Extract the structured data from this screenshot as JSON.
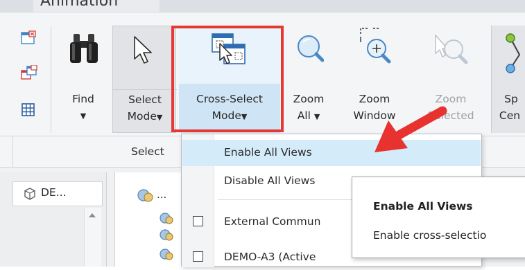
{
  "tab": {
    "label": "Animation"
  },
  "ribbon": {
    "find_label": "Find",
    "select_mode": {
      "line1": "Select",
      "line2": "Mode"
    },
    "cross_select_mode": {
      "line1": "Cross-Select",
      "line2": "Mode"
    },
    "zoom_all": {
      "line1": "Zoom",
      "line2": "All"
    },
    "zoom_window": {
      "line1": "Zoom",
      "line2": "Window"
    },
    "zoom_selected": {
      "line1": "Zoom",
      "line2": "Selected"
    },
    "spin_center": {
      "line1": "Sp",
      "line2": "Cen"
    },
    "group_label": "Select",
    "caret": "▼"
  },
  "panel": {
    "tab_label": "DE..."
  },
  "dropdown": {
    "items": [
      {
        "label": "Enable All Views"
      },
      {
        "label": "Disable All Views"
      },
      {
        "label": "External Commun"
      },
      {
        "label": "DEMO-A3 (Active"
      }
    ]
  },
  "tooltip": {
    "title": "Enable All Views",
    "body": "Enable cross-selectio"
  },
  "colors": {
    "highlight_box": "#e53935",
    "arrow": "#e8322f",
    "menu_hover": "#d4ebf9",
    "ribbon_bg": "#f4f5f6"
  }
}
